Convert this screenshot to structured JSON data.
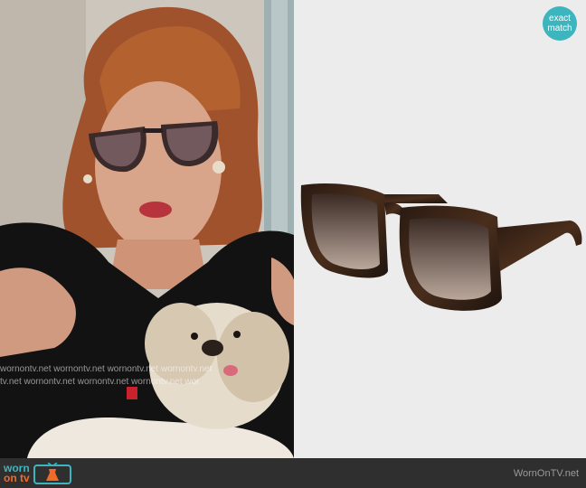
{
  "badge": {
    "line1": "exact",
    "line2": "match"
  },
  "watermark": {
    "rows": [
      "wornontv.net wornontv.net wornontv.net wornontv.net",
      "tv.net wornontv.net wornontv.net wornontv.net wor"
    ]
  },
  "footer": {
    "logo_word1": "worn",
    "logo_word2": "on tv",
    "site": "WornOnTV.net"
  },
  "colors": {
    "accent_teal": "#3db5bf",
    "accent_orange": "#f06b2a",
    "footer_bg": "#2f2f2f",
    "product_bg": "#ececec"
  }
}
